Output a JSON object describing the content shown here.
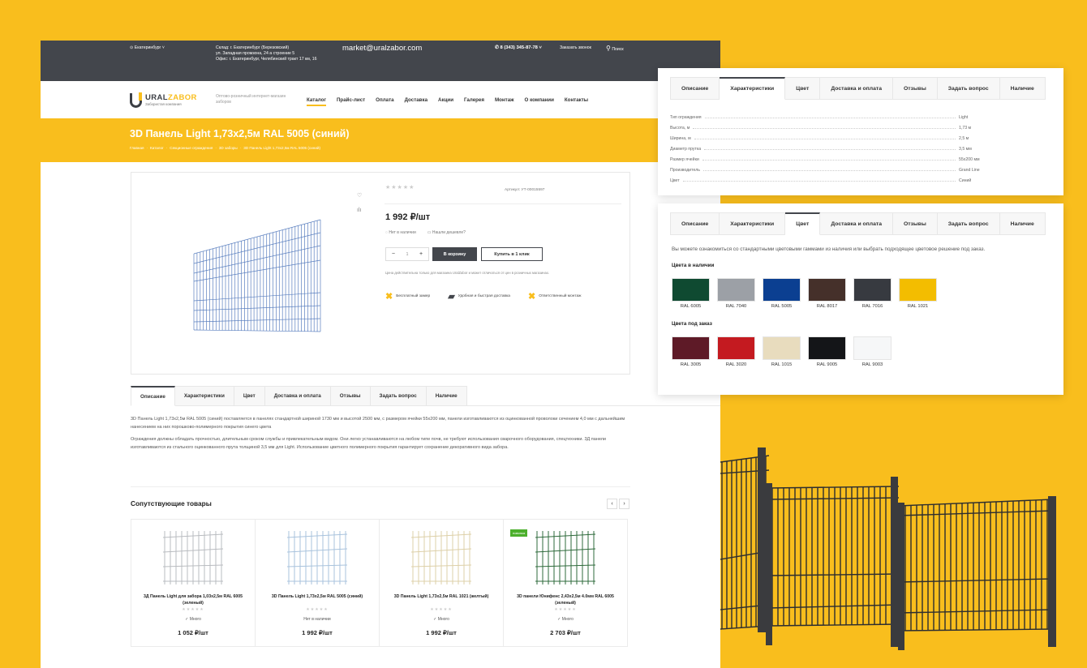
{
  "topbar": {
    "city": "Екатеринбург",
    "address_lines": [
      "Склад: г. Екатеринбург (Березовский)",
      "ул. Западная промзона, 24 а строение 5",
      "Офис: г. Екатеринбург, Челябинский тракт 17 км, 16"
    ],
    "email": "market@uralzabor.com",
    "phone": "8 (343) 345-87-78",
    "callback": "Заказать звонок",
    "search": "Поиск"
  },
  "header": {
    "logo_main": "URAL",
    "logo_accent": "ZABOR",
    "logo_sub": "Забористая компания",
    "tagline": "Оптово-розничный интернет-магазин заборов",
    "nav": [
      "Каталог",
      "Прайс-лист",
      "Оплата",
      "Доставка",
      "Акции",
      "Галерея",
      "Монтаж",
      "О компании",
      "Контакты"
    ]
  },
  "banner": {
    "title": "3D Панель Light 1,73х2,5м RAL 5005 (синий)",
    "breadcrumbs": [
      "Главная",
      "·",
      "Каталог",
      "·",
      "Секционные ограждения",
      "·",
      "3D заборы",
      "·",
      "3D Панель Light 1,73х2,5м RAL 5005 (синий)"
    ]
  },
  "product": {
    "stars": "★★★★★",
    "sku": "Артикул: УТ-00015597",
    "price": "1 992 ₽/шт",
    "stock": "Нет в наличии",
    "cheaper": "Нашли дешевле?",
    "qty": "1",
    "qty_minus": "−",
    "qty_plus": "+",
    "cart_button": "В корзину",
    "oneclick_button": "Купить в 1 клик",
    "note": "Цена действительна только для магазина UralZabor и может отличаться от цен в розничных магазинах.",
    "features": [
      "Бесплатный замер",
      "Удобная и быстрая доставка",
      "Ответственный монтаж"
    ]
  },
  "tabs": [
    "Описание",
    "Характеристики",
    "Цвет",
    "Доставка и оплата",
    "Отзывы",
    "Задать вопрос",
    "Наличие"
  ],
  "description": [
    "3D Панель Light 1,73х2,5м RAL 5005 (синий) поставляется в панелях стандартной шириной 1730 мм и высотой 2500 мм, с размером ячейки 55х200 мм, панели изготавливаются из оцинкованной проволоки сечением 4,0 мм с дальнейшим нанесением на них порошково-полимерного покрытия синего цвета",
    "Ограждения должны обладать прочностью, длительным сроком службы и привлекательным видом. Они легко устанавливаются на любом типе почв, не требуют использования сварочного оборудования, спецтехники. 3Д панели изготавливаются из стального оцинкованного прута толщиной 3,5 мм для Light. Использование цветного полимерного покрытия гарантирует сохранение декоративного вида забора."
  ],
  "related": {
    "title": "Сопутствующие товары",
    "prev": "‹",
    "next": "›",
    "items": [
      {
        "name": "3Д Панель Light для забора 1,03х2,5м RAL 6005 (зеленый)",
        "stock": "✓ Много",
        "price": "1 052 ₽/шт",
        "badge": "",
        "color": "#b9bcc0"
      },
      {
        "name": "3D Панель Light 1,73х2,5м RAL 5005 (синий)",
        "stock": "Нет в наличии",
        "price": "1 992 ₽/шт",
        "badge": "",
        "color": "#a9c3dd"
      },
      {
        "name": "3D Панель Light 1,73х2,5м RAL 1021 (желтый)",
        "stock": "✓ Много",
        "price": "1 992 ₽/шт",
        "badge": "",
        "color": "#ddd0a8"
      },
      {
        "name": "3D панели Юнифенс 2,43х2,5м 4.0мм RAL 6005 (зеленый)",
        "stock": "✓ Много",
        "price": "2 703 ₽/шт",
        "badge": "новинка",
        "color": "#2f6b3c"
      }
    ]
  },
  "specs": [
    {
      "k": "Тип ограждения",
      "v": "Light"
    },
    {
      "k": "Высота, м",
      "v": "1,73 м"
    },
    {
      "k": "Ширина, м",
      "v": "2,5 м"
    },
    {
      "k": "Диаметр прутка",
      "v": "3,5 мм"
    },
    {
      "k": "Размер ячейки",
      "v": "55х200 мм"
    },
    {
      "k": "Производитель",
      "v": "Grand Line"
    },
    {
      "k": "Цвет",
      "v": "Синий"
    }
  ],
  "colors": {
    "intro": "Вы можете ознакомиться со стандартными цветовыми гаммами из наличия или выбрать подходящее цветовое решение под заказ.",
    "in_stock_title": "Цвета в наличии",
    "in_stock": [
      {
        "name": "RAL 6005",
        "hex": "#0f4a31"
      },
      {
        "name": "RAL 7040",
        "hex": "#9ca0a6"
      },
      {
        "name": "RAL 5005",
        "hex": "#0b3f91"
      },
      {
        "name": "RAL 8017",
        "hex": "#45302a"
      },
      {
        "name": "RAL 7016",
        "hex": "#373a40"
      },
      {
        "name": "RAL 1021",
        "hex": "#f3bd00"
      }
    ],
    "order_title": "Цвета под заказ",
    "order": [
      {
        "name": "RAL 3005",
        "hex": "#5e1a27"
      },
      {
        "name": "RAL 3020",
        "hex": "#c41a20"
      },
      {
        "name": "RAL 1015",
        "hex": "#e8dcbe"
      },
      {
        "name": "RAL 9005",
        "hex": "#141518"
      },
      {
        "name": "RAL 9003",
        "hex": "#f6f7f8"
      }
    ]
  }
}
